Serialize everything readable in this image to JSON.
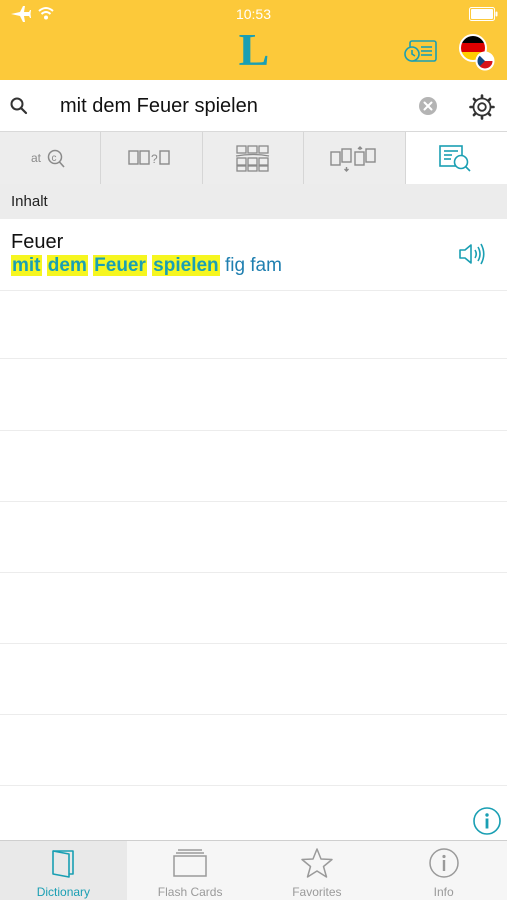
{
  "status_bar": {
    "time": "10:53"
  },
  "header": {
    "logo_text": "L"
  },
  "search": {
    "value": "mit dem Feuer spielen"
  },
  "mode_tabs": [
    {
      "id": "word-search",
      "icon": "a-to-c-search-icon"
    },
    {
      "id": "fill-in",
      "icon": "fill-in-question-icon"
    },
    {
      "id": "crossword",
      "icon": "grid-puzzle-icon"
    },
    {
      "id": "card-sort",
      "icon": "card-sort-icon"
    },
    {
      "id": "full-text",
      "icon": "fulltext-search-icon",
      "active": true
    }
  ],
  "section": {
    "title": "Inhalt"
  },
  "result": {
    "headword": "Feuer",
    "phrase_words": [
      "mit",
      "dem",
      "Feuer",
      "spielen"
    ],
    "tags": "fig fam"
  },
  "tab_bar": [
    {
      "label": "Dictionary",
      "icon": "book-icon",
      "active": true
    },
    {
      "label": "Flash Cards",
      "icon": "cards-icon"
    },
    {
      "label": "Favorites",
      "icon": "star-icon"
    },
    {
      "label": "Info",
      "icon": "info-icon"
    }
  ],
  "colors": {
    "header": "#fcc93a",
    "accent": "#1a9fb3",
    "highlight": "#f6f620"
  }
}
